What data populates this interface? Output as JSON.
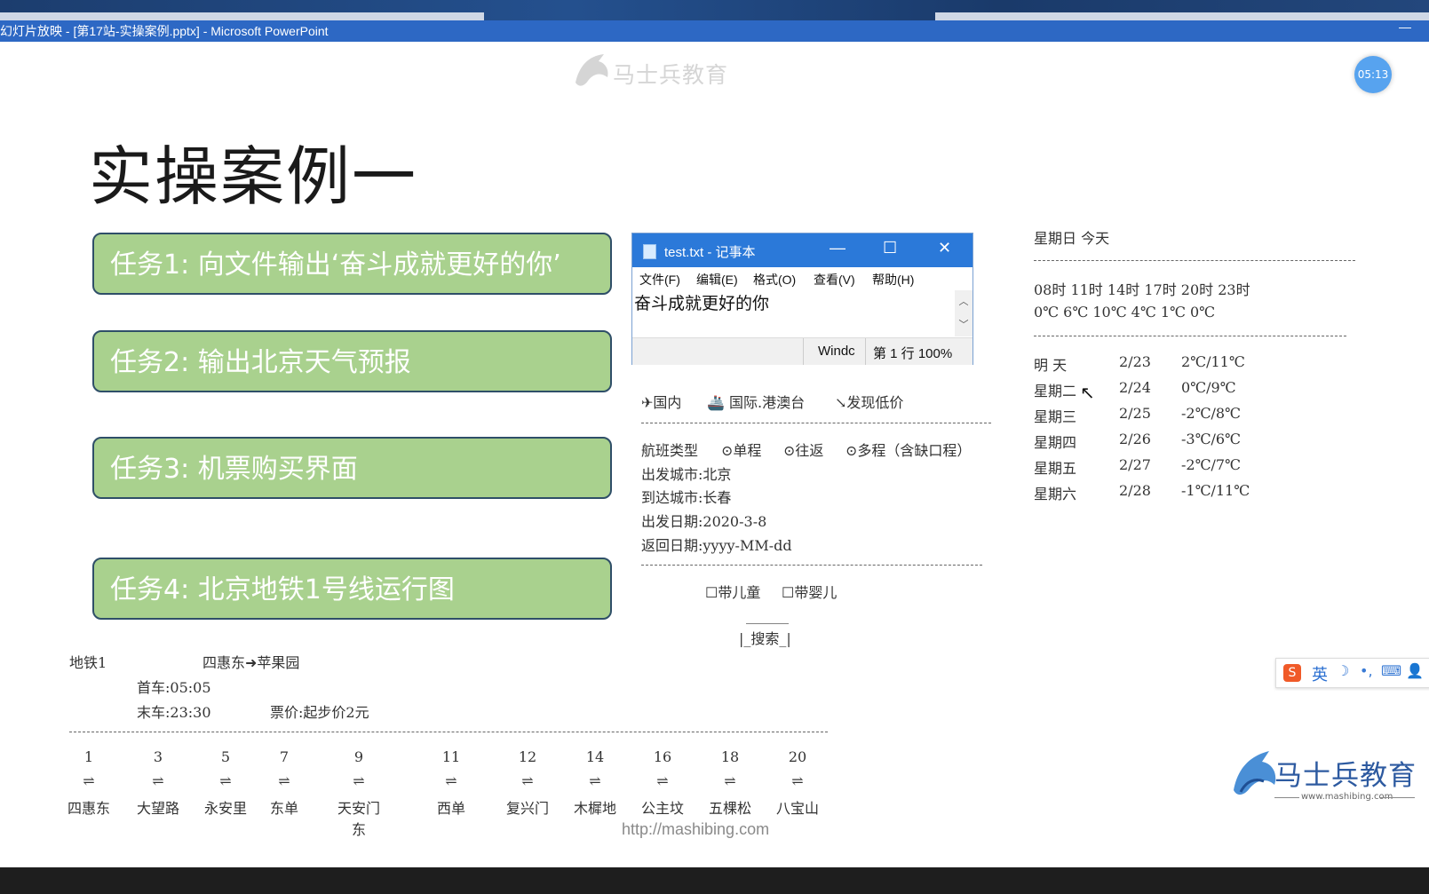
{
  "window": {
    "title": "幻灯片放映 - [第17站-实操案例.pptx] - Microsoft PowerPoint",
    "minimize": "—"
  },
  "watermark": {
    "brand": "马士兵教育",
    "url": "www.mashibing.com"
  },
  "timer": "05:13",
  "slide": {
    "title": "实操案例一",
    "tasks": [
      "任务1:  向文件输出‘奋斗成就更好的你’",
      "任务2:  输出北京天气预报",
      "任务3:  机票购买界面",
      "任务4:  北京地铁1号线运行图"
    ],
    "footer_url": "http://mashibing.com"
  },
  "notepad": {
    "title": "test.txt - 记事本",
    "buttons": {
      "minimize": "—",
      "maximize": "☐",
      "close": "✕"
    },
    "menu": [
      "文件(F)",
      "编辑(E)",
      "格式(O)",
      "查看(V)",
      "帮助(H)"
    ],
    "content": "奋斗成就更好的你",
    "status": {
      "encoding": "Windc",
      "position": "第 1 行 100%"
    }
  },
  "flight": {
    "tabs": [
      "✈国内",
      "🚢 国际.港澳台",
      "↘发现低价"
    ],
    "route_type_label": "航班类型",
    "route_options": [
      "⊙单程",
      "⊙往返",
      "⊙多程（含缺口程）"
    ],
    "depart_city": "出发城市:北京",
    "arrive_city": "到达城市:长春",
    "depart_date": "出发日期:2020-3-8",
    "return_date": "返回日期:yyyy-MM-dd",
    "checkbox_child": "☐带儿童",
    "checkbox_infant": "☐带婴儿",
    "search_top": "______",
    "search_label": "|_搜索_|"
  },
  "weather": {
    "header": "星期日  今天",
    "hours": "08时  11时  14时  17时  20时  23时",
    "temps": "0℃   6℃   10℃   4℃   1℃   0℃",
    "forecast": [
      {
        "day": "明  天",
        "date": "2/23",
        "range": "2℃/11℃"
      },
      {
        "day": "星期二",
        "date": "2/24",
        "range": "0℃/9℃"
      },
      {
        "day": "星期三",
        "date": "2/25",
        "range": "-2℃/8℃"
      },
      {
        "day": "星期四",
        "date": "2/26",
        "range": "-3℃/6℃"
      },
      {
        "day": "星期五",
        "date": "2/27",
        "range": "-2℃/7℃"
      },
      {
        "day": "星期六",
        "date": "2/28",
        "range": "-1℃/11℃"
      }
    ]
  },
  "subway": {
    "line": "地铁1",
    "direction": "四惠东➜苹果园",
    "first_train": "首车:05:05",
    "last_train": "末车:23:30",
    "fare": "票价:起步价2元",
    "arrow": "⇌",
    "stations": [
      {
        "no": "1",
        "name": "四惠东"
      },
      {
        "no": "3",
        "name": "大望路"
      },
      {
        "no": "5",
        "name": "永安里"
      },
      {
        "no": "7",
        "name": "东单"
      },
      {
        "no": "9",
        "name": "天安门东"
      },
      {
        "no": "11",
        "name": "西单"
      },
      {
        "no": "12",
        "name": "复兴门"
      },
      {
        "no": "14",
        "name": "木樨地"
      },
      {
        "no": "16",
        "name": "公主坟"
      },
      {
        "no": "18",
        "name": "五棵松"
      },
      {
        "no": "20",
        "name": "八宝山"
      }
    ]
  },
  "ime": {
    "logo": "S",
    "mode": "英",
    "icons": [
      "☽",
      "•,",
      "⌨",
      "👤"
    ]
  },
  "colors": {
    "task_fill": "#a9d18e",
    "task_border": "#2f4f68",
    "titlebar": "#2d68c4",
    "notepad_title": "#2b79d9",
    "timer": "#57a3ef"
  }
}
